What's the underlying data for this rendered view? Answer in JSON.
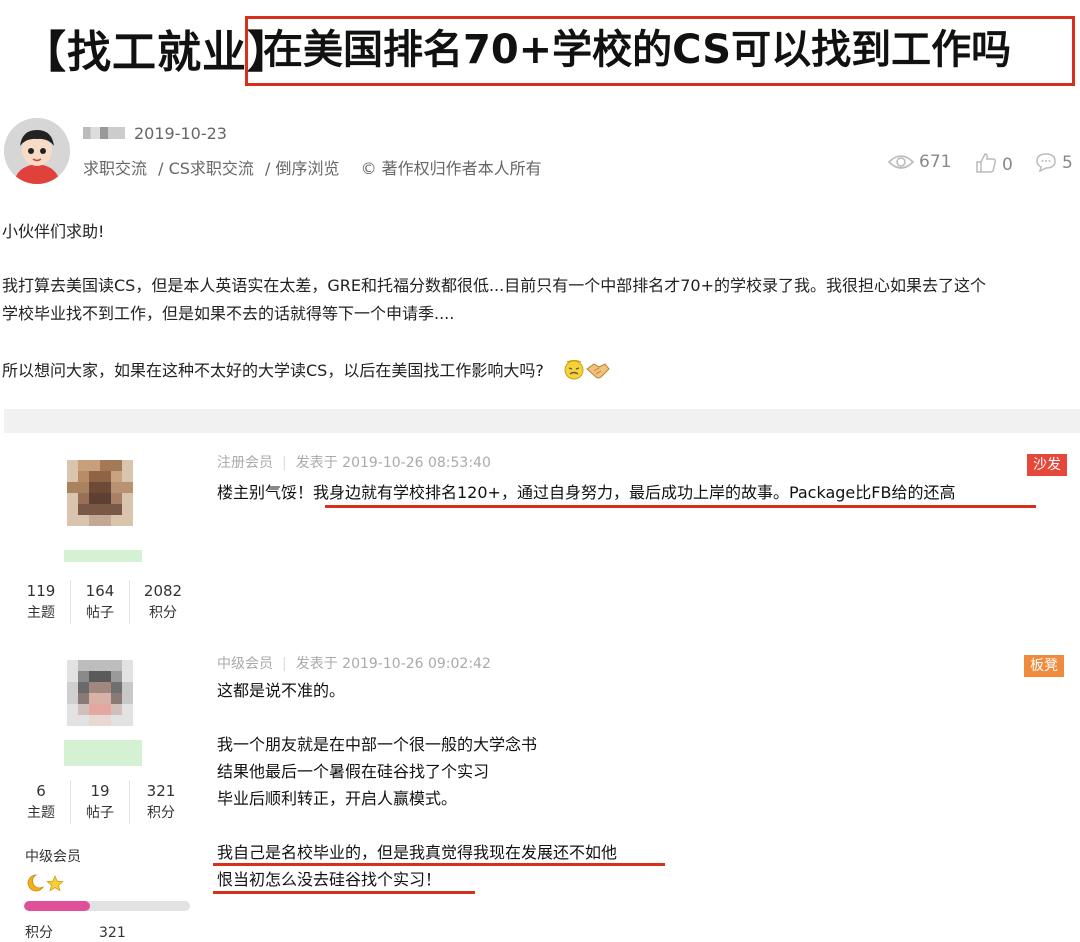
{
  "headline": {
    "prefix": "【找工就业】",
    "title": "在美国排名70+学校的CS可以找到工作吗"
  },
  "thread": {
    "date": "2019-10-23",
    "breadcrumb": [
      "求职交流",
      "/ CS求职交流",
      "/ 倒序浏览"
    ],
    "copyright": "© 著作权归作者本人所有",
    "views": "671",
    "likes": "0",
    "comments": "5",
    "paragraphs": [
      "小伙伴们求助!",
      "我打算去美国读CS，但是本人英语实在太差，GRE和托福分数都很低...目前只有一个中部排名才70+的学校录了我。我很担心如果去了这个",
      "学校毕业找不到工作，但是如果不去的话就得等下一个申请季....",
      "所以想问大家，如果在这种不太好的大学读CS，以后在美国找工作影响大吗?"
    ]
  },
  "replies": [
    {
      "role": "注册会员",
      "posted": "发表于 2019-10-26 08:53:40",
      "badge": "沙发",
      "badge_color": "#e5483a",
      "stats": [
        {
          "value": "119",
          "label": "主题"
        },
        {
          "value": "164",
          "label": "帖子"
        },
        {
          "value": "2082",
          "label": "积分"
        }
      ],
      "lines": [
        "楼主别气馁！我身边就有学校排名120+，通过自身努力，最后成功上岸的故事。Package比FB给的还高"
      ]
    },
    {
      "role": "中级会员",
      "posted": "发表于 2019-10-26 09:02:42",
      "badge": "板凳",
      "badge_color": "#f08a3c",
      "stats": [
        {
          "value": "6",
          "label": "主题"
        },
        {
          "value": "19",
          "label": "帖子"
        },
        {
          "value": "321",
          "label": "积分"
        }
      ],
      "level_label": "中级会员",
      "level_progress": 0.4,
      "points_label": "积分",
      "points_value": "321",
      "lines": [
        "这都是说不准的。",
        "我一个朋友就是在中部一个很一般的大学念书",
        "结果他最后一个暑假在硅谷找了个实习",
        "毕业后顺利转正，开启人赢模式。",
        "我自己是名校毕业的，但是我真觉得我现在发展还不如他",
        "恨当初怎么没去硅谷找个实习！"
      ]
    }
  ],
  "colors": {
    "accent_red": "#d9301e",
    "level_bar": "#e0509a"
  }
}
